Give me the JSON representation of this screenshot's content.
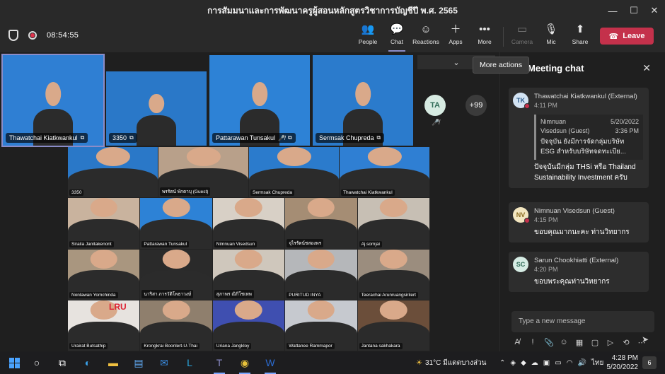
{
  "window": {
    "title": "การสัมมนาและการพัฒนาครูผู้สอนหลักสูตรวิชาการบัญชีปี พ.ศ. 2565",
    "controls": {
      "minimize": "—",
      "maximize": "☐",
      "close": "✕"
    }
  },
  "toolbar": {
    "timer": "08:54:55",
    "buttons": {
      "people": "People",
      "chat": "Chat",
      "reactions": "Reactions",
      "apps": "Apps",
      "more": "More",
      "camera": "Camera",
      "mic": "Mic",
      "share": "Share"
    },
    "leave": "Leave"
  },
  "stage": {
    "tooltip": "More actions",
    "featured": [
      {
        "name": "Thawatchai Kiatkwankul",
        "color": "#2f7fd3"
      },
      {
        "name": "3350",
        "color": "#2a78c8"
      },
      {
        "name": "Pattarawan Tunsakul",
        "color": "#2d82d6",
        "muted": "🎤̸"
      },
      {
        "name": "Sermsak Chupreda",
        "color": "#2b7bcc"
      }
    ],
    "ta_avatar": "TA",
    "overflow_count": "+99",
    "gallery": [
      {
        "name": "3350",
        "color": "#2a78c8"
      },
      {
        "name": "พรรัตน์ พักดาบุ (Guest)",
        "color": "#b8a08a"
      },
      {
        "name": "Sermsak Chupreda",
        "color": "#2b7bcc"
      },
      {
        "name": "Thawatchai Kiatkwankul",
        "color": "#2f7fd3"
      },
      {
        "name": "Siraila Janitakenont",
        "color": "#c9b39e"
      },
      {
        "name": "Pattarawan Tunsakul",
        "color": "#2d82d6"
      },
      {
        "name": "Nimnuan Visedsun",
        "color": "#d8d0c6"
      },
      {
        "name": "จุไรรัตน์ชสองพร",
        "color": "#a58d74"
      },
      {
        "name": "Aj.somjai",
        "color": "#c7bfb4"
      },
      {
        "name": "Nonlawan Yomchinda",
        "color": "#a9967f"
      },
      {
        "name": "นาริสา ภารวัติโพธาวงษ์",
        "color": "#2a2a2a"
      },
      {
        "name": "สุภาพร ณิกิโชเทพ",
        "color": "#cfc7bc"
      },
      {
        "name": "PURITUD INYA",
        "color": "#b5b7ba"
      },
      {
        "name": "Teerachai Arunruangsirilert",
        "color": "#9b8d7e"
      },
      {
        "name": "Urairat Butsathip",
        "color": "#e7e3df",
        "logo": "LRU"
      },
      {
        "name": "Krongkrai Boonlert-U-Thai",
        "color": "#8f7f6d"
      },
      {
        "name": "Uriana Jangkloy",
        "color": "#3f4fb0"
      },
      {
        "name": "Wattanee Rammapor",
        "color": "#c6c9cf"
      },
      {
        "name": "Jantana sakhakara",
        "color": "#6b4e3a"
      }
    ]
  },
  "chat": {
    "title": "Meeting chat",
    "messages": [
      {
        "initials": "TK",
        "av_color": "#d2e3f3",
        "av_text": "#2a5a8a",
        "sender": "Thawatchai Kiatkwankul (External)",
        "time": "4:11 PM",
        "quote": {
          "sender_line1": "Nimnuan",
          "sender_line2": "Visedsun (Guest)",
          "date": "5/20/2022",
          "time": "3:36 PM",
          "text": "ปัจจุบัน ยังมีการจัดกลุ่มบริษัท ESG สำหรับบริษัทจดทะเบีย..."
        },
        "text": "ปัจจุบันมีกลุ่ม THSi หรือ Thailand Sustainability Investment ครับ"
      },
      {
        "initials": "NV",
        "av_color": "#f3e6c0",
        "av_text": "#8a6a1e",
        "sender": "Nimnuan Visedsun (Guest)",
        "time": "4:15 PM",
        "text": "ขอบคุณมากนะคะ ท่านวิทยากร"
      },
      {
        "initials": "SC",
        "av_color": "#d6ece4",
        "av_text": "#2f6b57",
        "sender": "Sarun Chookhiatti (External)",
        "time": "4:20 PM",
        "text": "ขอบพระคุณท่านวิทยากร"
      }
    ],
    "compose_placeholder": "Type a new message"
  },
  "taskbar": {
    "weather": "31°C  มีแดดบางส่วน",
    "lang": "ไทย",
    "time": "4:28 PM",
    "date": "5/20/2022",
    "notifications": "6"
  }
}
